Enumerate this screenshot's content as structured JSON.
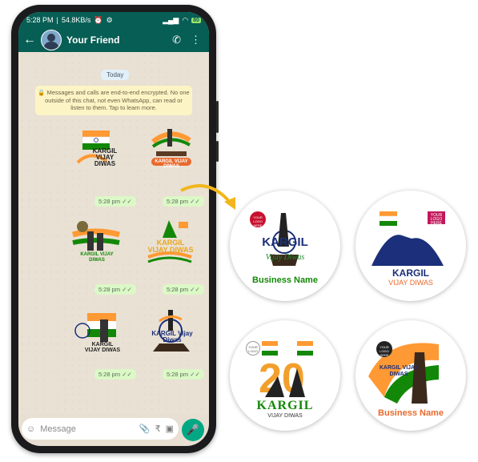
{
  "status_bar": {
    "time": "5:28 PM",
    "speed": "54.8KB/s",
    "icons": [
      "alarm-icon",
      "settings-icon"
    ],
    "right_icons": [
      "signal-icon",
      "wifi-icon",
      "battery-icon"
    ],
    "battery": "80"
  },
  "app_bar": {
    "contact_name": "Your Friend",
    "icons": [
      "back-arrow-icon",
      "add-call-icon",
      "more-options-icon"
    ]
  },
  "chat": {
    "date_label": "Today",
    "encryption_notice": "Messages and calls are end-to-end encrypted. No one outside of this chat, not even WhatsApp, can read or listen to them. Tap to learn more.",
    "stickers": [
      {
        "text": "KARGIL VIJAY DIWAS",
        "time": "5:28 pm"
      },
      {
        "text": "KARGIL VIJAY DIWAS",
        "time": "5:28 pm"
      },
      {
        "text": "KARGIL VIJAY DIWAS",
        "time": "5:28 pm"
      },
      {
        "text": "KARGIL VIJAY DIWAS",
        "time": "5:28 pm"
      },
      {
        "text": "KARGIL VIJAY DIWAS",
        "time": "5:28 pm"
      },
      {
        "text": "KARGIL Vijay Diwas",
        "time": "5:28 pm"
      }
    ]
  },
  "compose": {
    "placeholder": "Message",
    "icons": [
      "emoji-icon",
      "attach-icon",
      "rupee-icon",
      "camera-icon",
      "mic-icon"
    ]
  },
  "circles": [
    {
      "logo": "YOUR LOGO HERE",
      "title": "KARGIL",
      "subtitle": "Vijay Diwas",
      "business": "Business Name"
    },
    {
      "logo": "YOUR LOGO HERE",
      "title": "KARGIL",
      "subtitle": "VIJAY DIWAS"
    },
    {
      "logo": "YOUR LOGO",
      "title": "KARGIL",
      "subtitle": "VIJAY DIWAS"
    },
    {
      "logo": "YOUR LOGO HERE",
      "title": "KARGIL VIJAY DIWAS",
      "business": "Business Name"
    }
  ],
  "colors": {
    "whatsapp_green": "#075e54",
    "saffron": "#ff9933",
    "india_green": "#138808",
    "navy": "#1b2f7a"
  }
}
